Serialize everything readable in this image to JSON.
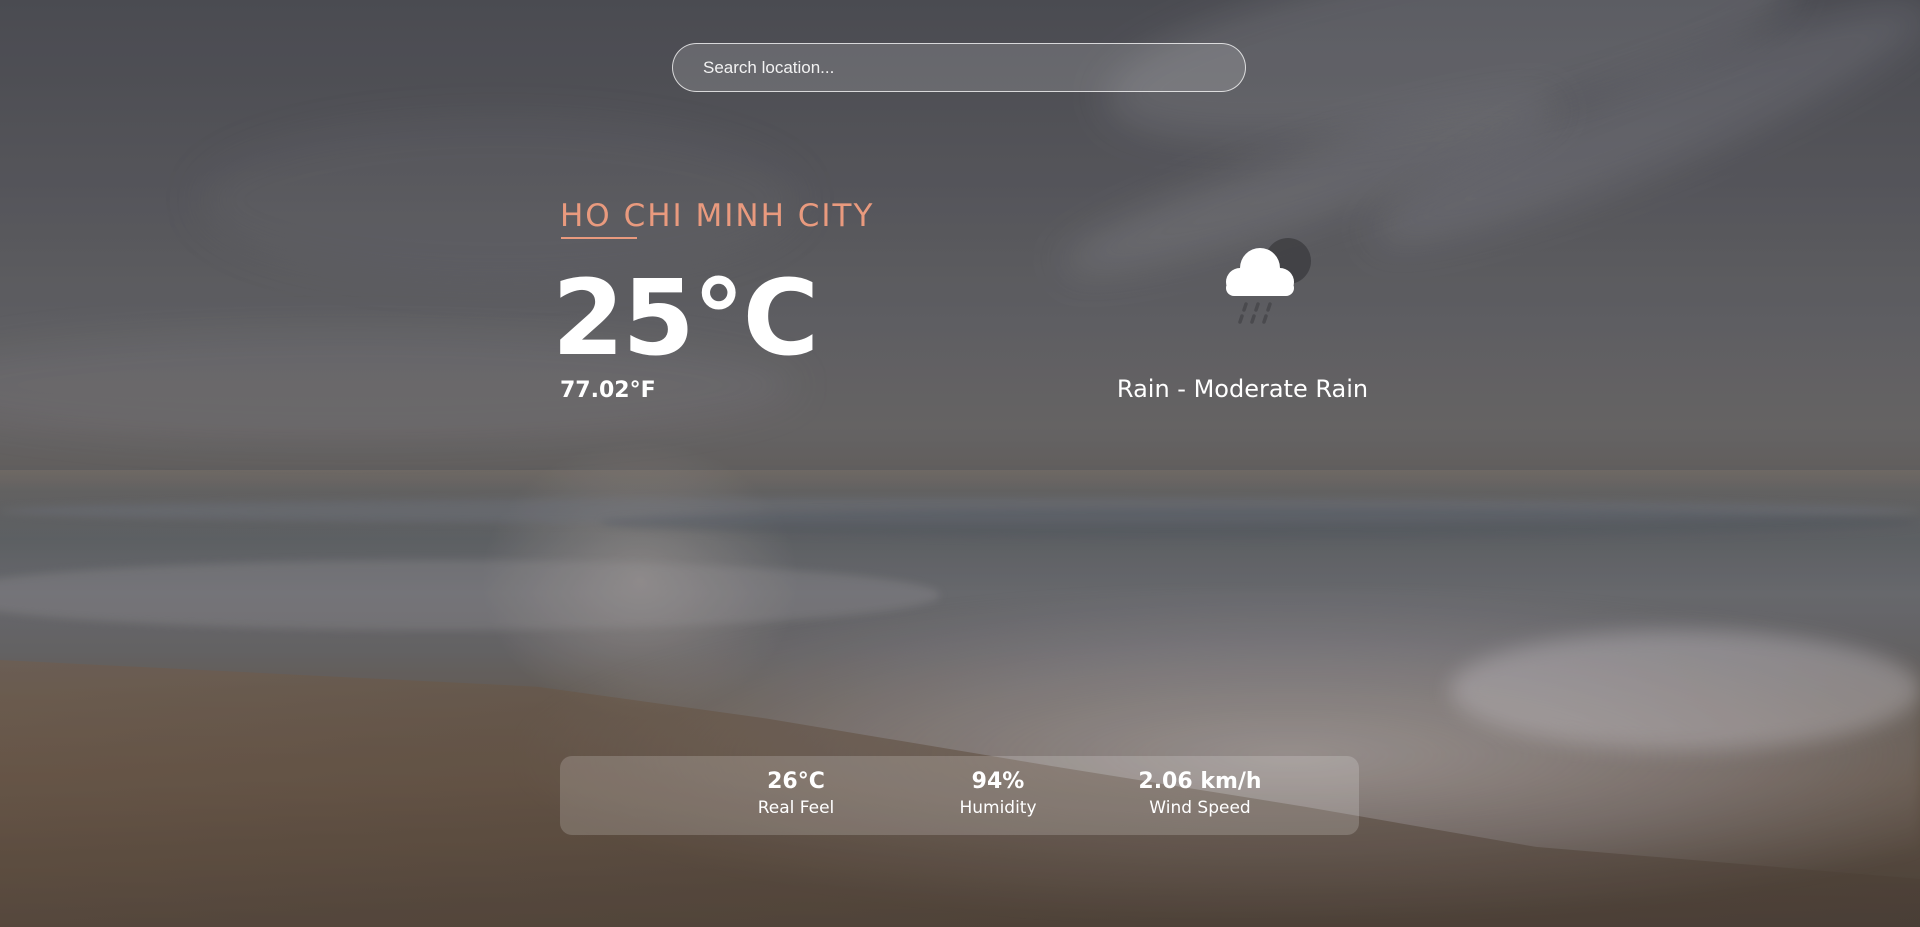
{
  "search": {
    "placeholder": "Search location..."
  },
  "location": {
    "city": "HO CHI MINH CITY"
  },
  "current": {
    "temp_c": "25°C",
    "temp_f": "77.02°F",
    "condition": "Rain - Moderate Rain",
    "icon": "cloud-rain-moon-icon"
  },
  "details": [
    {
      "value": "26°C",
      "label": "Real Feel"
    },
    {
      "value": "94%",
      "label": "Humidity"
    },
    {
      "value": "2.06 km/h",
      "label": "Wind Speed"
    }
  ],
  "colors": {
    "accent": "#e99a7e",
    "text": "#ffffff"
  }
}
